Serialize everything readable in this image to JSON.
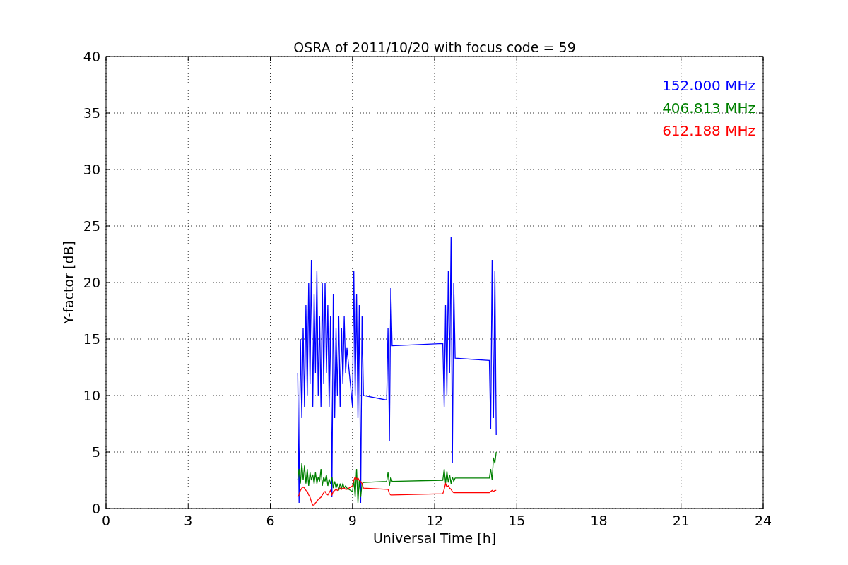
{
  "figure": {
    "chart_data": {
      "type": "line",
      "title": "OSRA of 2011/10/20 with focus code = 59",
      "xlabel": "Universal Time [h]",
      "ylabel": "Y-factor [dB]",
      "grid": true,
      "xlim": [
        0,
        24
      ],
      "ylim": [
        0,
        40
      ],
      "xticks": [
        0,
        3,
        6,
        9,
        12,
        15,
        18,
        21,
        24
      ],
      "yticks": [
        0,
        5,
        10,
        15,
        20,
        25,
        30,
        35,
        40
      ],
      "x": [
        7.0,
        7.05,
        7.1,
        7.15,
        7.2,
        7.25,
        7.3,
        7.35,
        7.4,
        7.45,
        7.5,
        7.55,
        7.6,
        7.65,
        7.7,
        7.75,
        7.8,
        7.85,
        7.9,
        7.95,
        8.0,
        8.05,
        8.1,
        8.15,
        8.2,
        8.25,
        8.3,
        8.35,
        8.4,
        8.45,
        8.5,
        8.55,
        8.6,
        8.65,
        8.7,
        8.75,
        8.8,
        9.0,
        9.05,
        9.1,
        9.15,
        9.2,
        9.25,
        9.3,
        9.35,
        9.4,
        10.25,
        10.3,
        10.35,
        10.4,
        10.45,
        12.3,
        12.35,
        12.4,
        12.45,
        12.5,
        12.55,
        12.6,
        12.65,
        12.7,
        12.75,
        14.0,
        14.05,
        14.1,
        14.15,
        14.2,
        14.25
      ],
      "series": [
        {
          "name": "152.000 MHz",
          "color": "#0000ff",
          "values": [
            12,
            0.5,
            15,
            8,
            16,
            9,
            18,
            10,
            20,
            11,
            22,
            9,
            19,
            12,
            21,
            10,
            17,
            9,
            20,
            11,
            20,
            12,
            18,
            9,
            17,
            1,
            19,
            8,
            16,
            10,
            17,
            9,
            16,
            11,
            17,
            12,
            14.2,
            9,
            21,
            10,
            19,
            8,
            18,
            0.5,
            17,
            10,
            9.6,
            16,
            6,
            19.5,
            14.4,
            14.6,
            9,
            18,
            10,
            21,
            12,
            24,
            4,
            20,
            13.3,
            13.1,
            7,
            22,
            8,
            21,
            6.5
          ]
        },
        {
          "name": "406.813 MHz",
          "color": "#008000",
          "values": [
            2.5,
            3.5,
            2.2,
            4,
            2.5,
            3.8,
            2.2,
            3.5,
            2,
            3.2,
            2.5,
            3,
            2.2,
            3.2,
            2.2,
            2.8,
            2.4,
            3.5,
            2,
            2.8,
            2.4,
            3,
            2,
            2.6,
            2.2,
            2.8,
            1.8,
            2.4,
            1.8,
            2.2,
            1.6,
            2.2,
            1.8,
            2.2,
            1.8,
            2,
            1.8,
            1.5,
            2.5,
            1,
            3.5,
            0.5,
            2.5,
            1,
            2.2,
            2.3,
            2.4,
            3.2,
            2,
            2.8,
            2.4,
            2.5,
            3.5,
            2.2,
            3.3,
            2.3,
            3,
            2.2,
            2.8,
            2.4,
            2.7,
            2.7,
            3.5,
            2.5,
            4.5,
            4.0,
            5
          ]
        },
        {
          "name": "612.188 MHz",
          "color": "#ff0000",
          "values": [
            1,
            1.2,
            1.6,
            1.8,
            1.9,
            1.8,
            1.6,
            1.5,
            1.2,
            1,
            0.6,
            0.3,
            0.3,
            0.5,
            0.6,
            0.8,
            0.9,
            1.0,
            1.2,
            1.4,
            1.5,
            1.3,
            1.2,
            1.4,
            1.6,
            1.2,
            1.5,
            1.6,
            1.7,
            1.6,
            1.7,
            1.8,
            1.7,
            1.8,
            1.8,
            1.7,
            1.7,
            2,
            2.5,
            2.8,
            2.6,
            2.7,
            2.5,
            2.4,
            2.2,
            1.8,
            1.7,
            1.7,
            1.3,
            1.2,
            1.2,
            1.3,
            1.7,
            2.2,
            1.9,
            2.0,
            1.8,
            1.7,
            1.5,
            1.4,
            1.4,
            1.4,
            1.5,
            1.6,
            1.5,
            1.6,
            1.6
          ]
        }
      ]
    }
  }
}
